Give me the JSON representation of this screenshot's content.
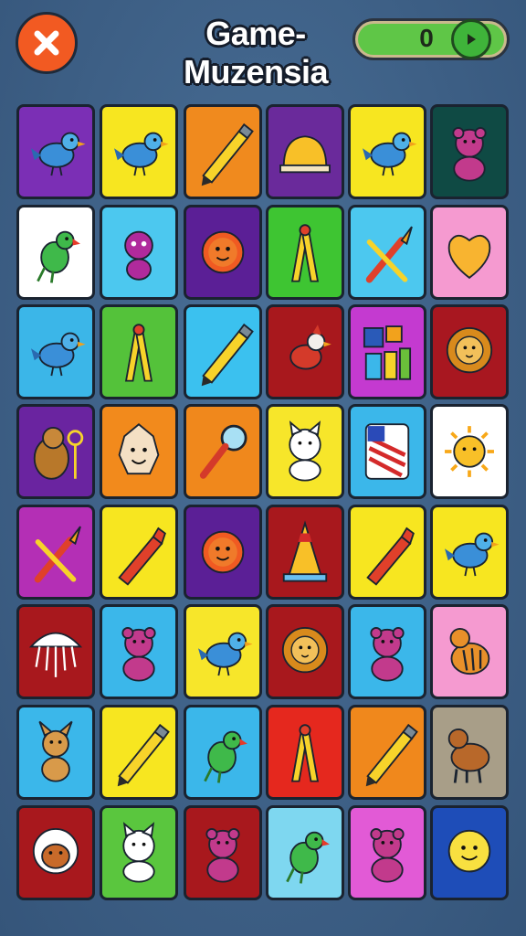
{
  "header": {
    "title": "Game-Muzensia",
    "score": "0"
  },
  "grid": {
    "rows": 8,
    "cols": 6,
    "tiles": [
      {
        "icon": "bird-icon",
        "color": "#7b2fb5"
      },
      {
        "icon": "bird-icon",
        "color": "#f7e620"
      },
      {
        "icon": "pencil-icon",
        "color": "#f08a1e"
      },
      {
        "icon": "bell-icon",
        "color": "#6a2a9b"
      },
      {
        "icon": "bird-icon",
        "color": "#f7e620"
      },
      {
        "icon": "bear-icon",
        "color": "#0f4a44"
      },
      {
        "icon": "parrot-icon",
        "color": "#ffffff"
      },
      {
        "icon": "alien-icon",
        "color": "#4cc8ef"
      },
      {
        "icon": "sun-icon",
        "color": "#5b1f96"
      },
      {
        "icon": "pliers-icon",
        "color": "#3ec532"
      },
      {
        "icon": "brush-icon",
        "color": "#4cc8ef"
      },
      {
        "icon": "heart-icon",
        "color": "#f59ad0"
      },
      {
        "icon": "bird-icon",
        "color": "#3bb6e8"
      },
      {
        "icon": "pliers-icon",
        "color": "#54c23a"
      },
      {
        "icon": "pencil-icon",
        "color": "#3bc1ef"
      },
      {
        "icon": "cardinal-icon",
        "color": "#a8181d"
      },
      {
        "icon": "paint-set-icon",
        "color": "#c43ad0"
      },
      {
        "icon": "lion-icon",
        "color": "#a81720"
      },
      {
        "icon": "beaver-icon",
        "color": "#6a24a0"
      },
      {
        "icon": "face-icon",
        "color": "#f28a1c"
      },
      {
        "icon": "magnifier-icon",
        "color": "#f0881c"
      },
      {
        "icon": "cat-icon",
        "color": "#f7e62a"
      },
      {
        "icon": "flag-icon",
        "color": "#3bb7ea"
      },
      {
        "icon": "sun-face-icon",
        "color": "#ffffff"
      },
      {
        "icon": "brush-icon",
        "color": "#b42fb5"
      },
      {
        "icon": "crayon-icon",
        "color": "#f7e620"
      },
      {
        "icon": "sun-icon",
        "color": "#5b1f96"
      },
      {
        "icon": "cone-icon",
        "color": "#a8181d"
      },
      {
        "icon": "crayon-icon",
        "color": "#f7e620"
      },
      {
        "icon": "bird-icon",
        "color": "#f7e620"
      },
      {
        "icon": "umbrella-icon",
        "color": "#a8181d"
      },
      {
        "icon": "bear-icon",
        "color": "#3bb7ea"
      },
      {
        "icon": "bird-icon",
        "color": "#f7e62a"
      },
      {
        "icon": "lion-icon",
        "color": "#a8181d"
      },
      {
        "icon": "bear-icon",
        "color": "#3bb7ea"
      },
      {
        "icon": "tiger-icon",
        "color": "#f59ad0"
      },
      {
        "icon": "fox-icon",
        "color": "#3bb7ea"
      },
      {
        "icon": "pencil-icon",
        "color": "#f7e620"
      },
      {
        "icon": "parrot-icon",
        "color": "#3bb7ea"
      },
      {
        "icon": "pliers-icon",
        "color": "#e5281e"
      },
      {
        "icon": "pencil-icon",
        "color": "#f0881c"
      },
      {
        "icon": "dog-icon",
        "color": "#a89e88"
      },
      {
        "icon": "monkey-icon",
        "color": "#a8181d"
      },
      {
        "icon": "cat-icon",
        "color": "#5ac63e"
      },
      {
        "icon": "bear-icon",
        "color": "#a8181d"
      },
      {
        "icon": "parrot-icon",
        "color": "#7ed7f0"
      },
      {
        "icon": "bear-icon",
        "color": "#e25ad6"
      },
      {
        "icon": "smiley-icon",
        "color": "#1e4db8"
      }
    ]
  }
}
